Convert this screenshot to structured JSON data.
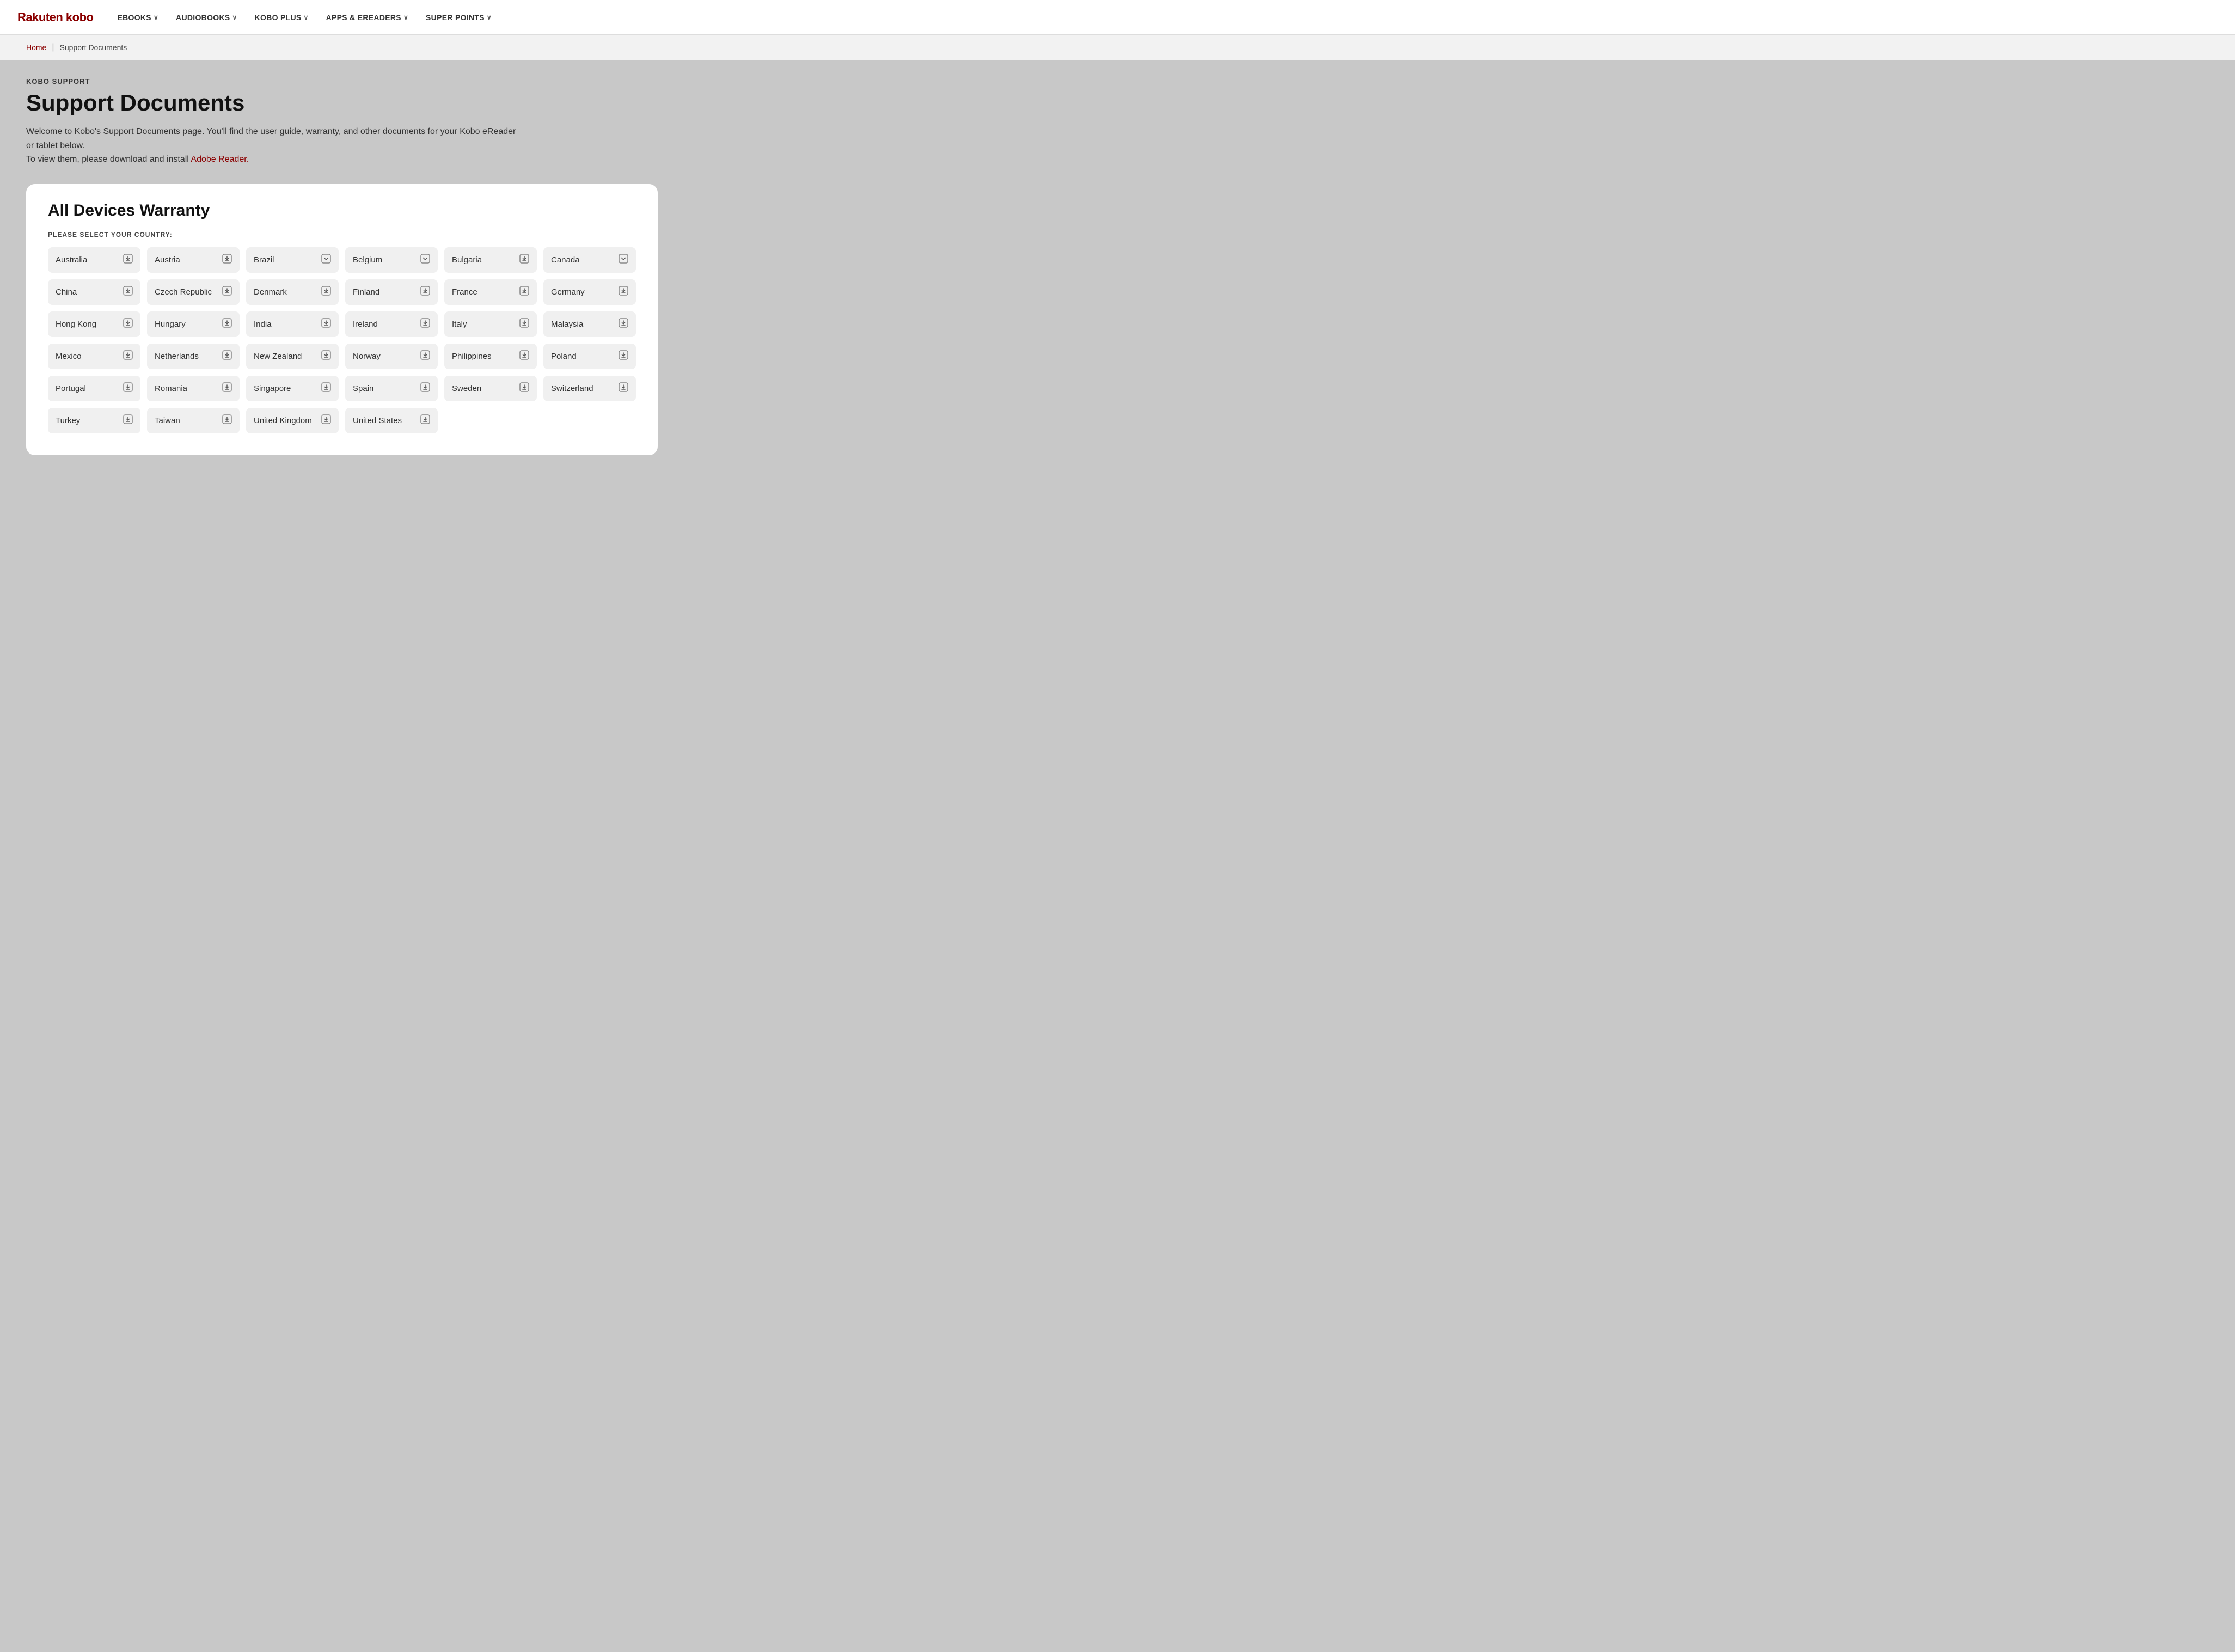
{
  "brand": {
    "name": "Rakuten kobo"
  },
  "nav": {
    "items": [
      {
        "label": "eBOOKS",
        "hasDropdown": true
      },
      {
        "label": "AUDIOBOOKS",
        "hasDropdown": true
      },
      {
        "label": "KOBO PLUS",
        "hasDropdown": true
      },
      {
        "label": "APPS & eREADERS",
        "hasDropdown": true
      },
      {
        "label": "SUPER POINTS",
        "hasDropdown": true
      }
    ]
  },
  "breadcrumb": {
    "home": "Home",
    "current": "Support Documents"
  },
  "page": {
    "section_label": "KOBO SUPPORT",
    "title": "Support Documents",
    "description_part1": "Welcome to Kobo's Support Documents page. You'll find the user guide, warranty, and other documents for your Kobo eReader or tablet below.",
    "description_part2": "To view them, please download and install ",
    "link_text": "Adobe Reader.",
    "link_end": ""
  },
  "card": {
    "title": "All Devices Warranty",
    "country_label": "PLEASE SELECT YOUR COUNTRY:",
    "countries": [
      {
        "name": "Australia",
        "icon": "download"
      },
      {
        "name": "Austria",
        "icon": "download"
      },
      {
        "name": "Brazil",
        "icon": "dropdown"
      },
      {
        "name": "Belgium",
        "icon": "dropdown"
      },
      {
        "name": "Bulgaria",
        "icon": "download"
      },
      {
        "name": "Canada",
        "icon": "dropdown"
      },
      {
        "name": "China",
        "icon": "download"
      },
      {
        "name": "Czech Republic",
        "icon": "download"
      },
      {
        "name": "Denmark",
        "icon": "download"
      },
      {
        "name": "Finland",
        "icon": "download"
      },
      {
        "name": "France",
        "icon": "download"
      },
      {
        "name": "Germany",
        "icon": "download"
      },
      {
        "name": "Hong Kong",
        "icon": "download"
      },
      {
        "name": "Hungary",
        "icon": "download"
      },
      {
        "name": "India",
        "icon": "download"
      },
      {
        "name": "Ireland",
        "icon": "download"
      },
      {
        "name": "Italy",
        "icon": "download"
      },
      {
        "name": "Malaysia",
        "icon": "download"
      },
      {
        "name": "Mexico",
        "icon": "download"
      },
      {
        "name": "Netherlands",
        "icon": "download"
      },
      {
        "name": "New Zealand",
        "icon": "download"
      },
      {
        "name": "Norway",
        "icon": "download"
      },
      {
        "name": "Philippines",
        "icon": "download"
      },
      {
        "name": "Poland",
        "icon": "download"
      },
      {
        "name": "Portugal",
        "icon": "download"
      },
      {
        "name": "Romania",
        "icon": "download"
      },
      {
        "name": "Singapore",
        "icon": "download"
      },
      {
        "name": "Spain",
        "icon": "download"
      },
      {
        "name": "Sweden",
        "icon": "download"
      },
      {
        "name": "Switzerland",
        "icon": "download"
      },
      {
        "name": "Turkey",
        "icon": "download"
      },
      {
        "name": "Taiwan",
        "icon": "download"
      },
      {
        "name": "United Kingdom",
        "icon": "download"
      },
      {
        "name": "United States",
        "icon": "download"
      }
    ]
  }
}
